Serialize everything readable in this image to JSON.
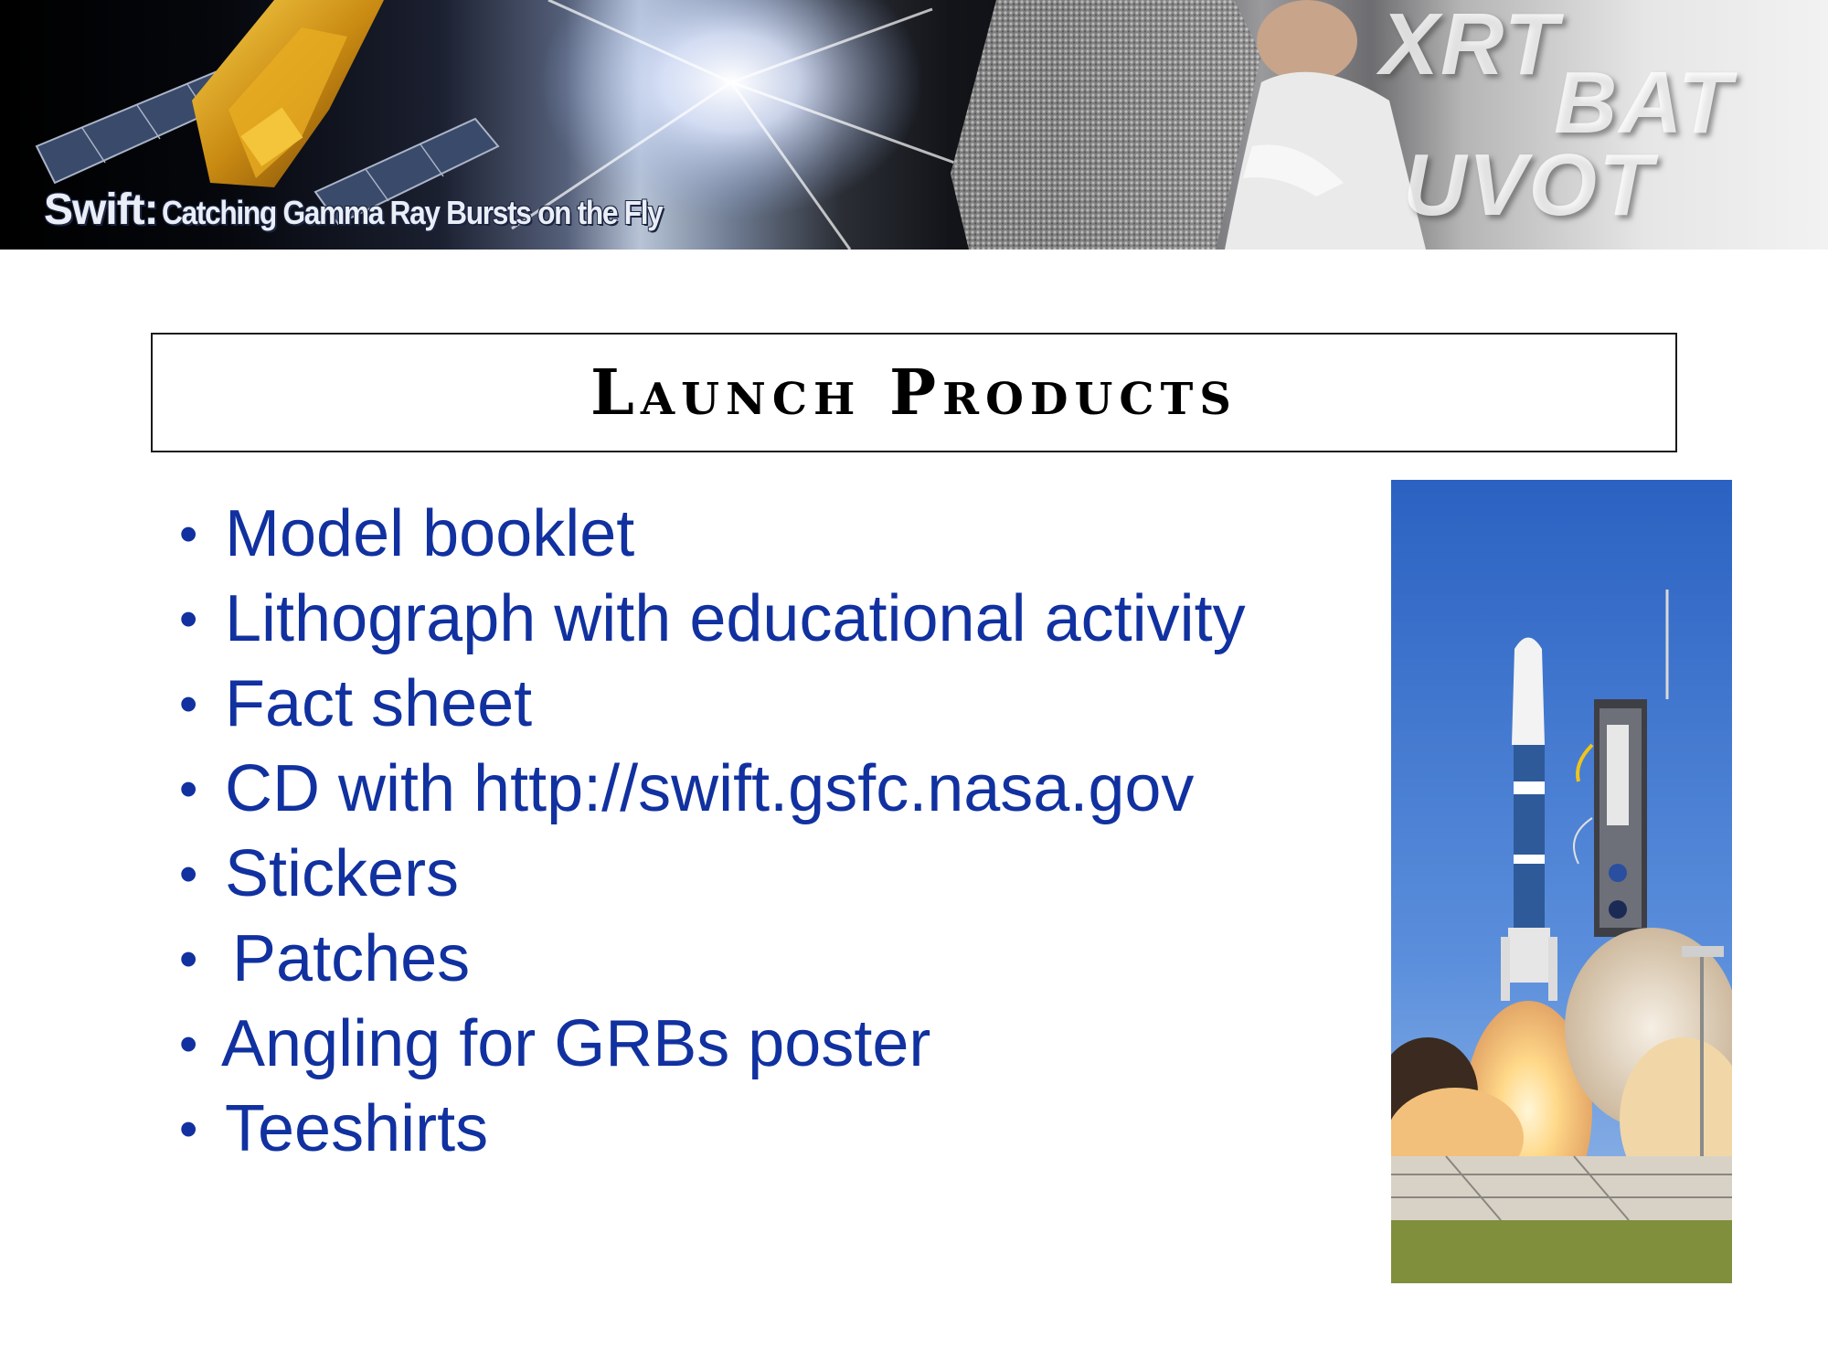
{
  "banner": {
    "swift": "Swift:",
    "tagline": "Catching Gamma Ray Bursts on the Fly",
    "instruments": [
      "XRT",
      "BAT",
      "UVOT"
    ]
  },
  "slide": {
    "title": "Launch Products",
    "bullet_glyph": "•",
    "bullets": [
      "Model booklet",
      "Lithograph with educational activity",
      "Fact sheet",
      "CD with http://swift.gsfc.nasa.gov",
      "Stickers",
      "Patches",
      "Angling for GRBs poster",
      "Teeshirts"
    ]
  },
  "colors": {
    "bullet_text": "#1131a0",
    "title_text": "#000000",
    "title_border": "#1a1a1a",
    "sky": "#2f69c8"
  }
}
